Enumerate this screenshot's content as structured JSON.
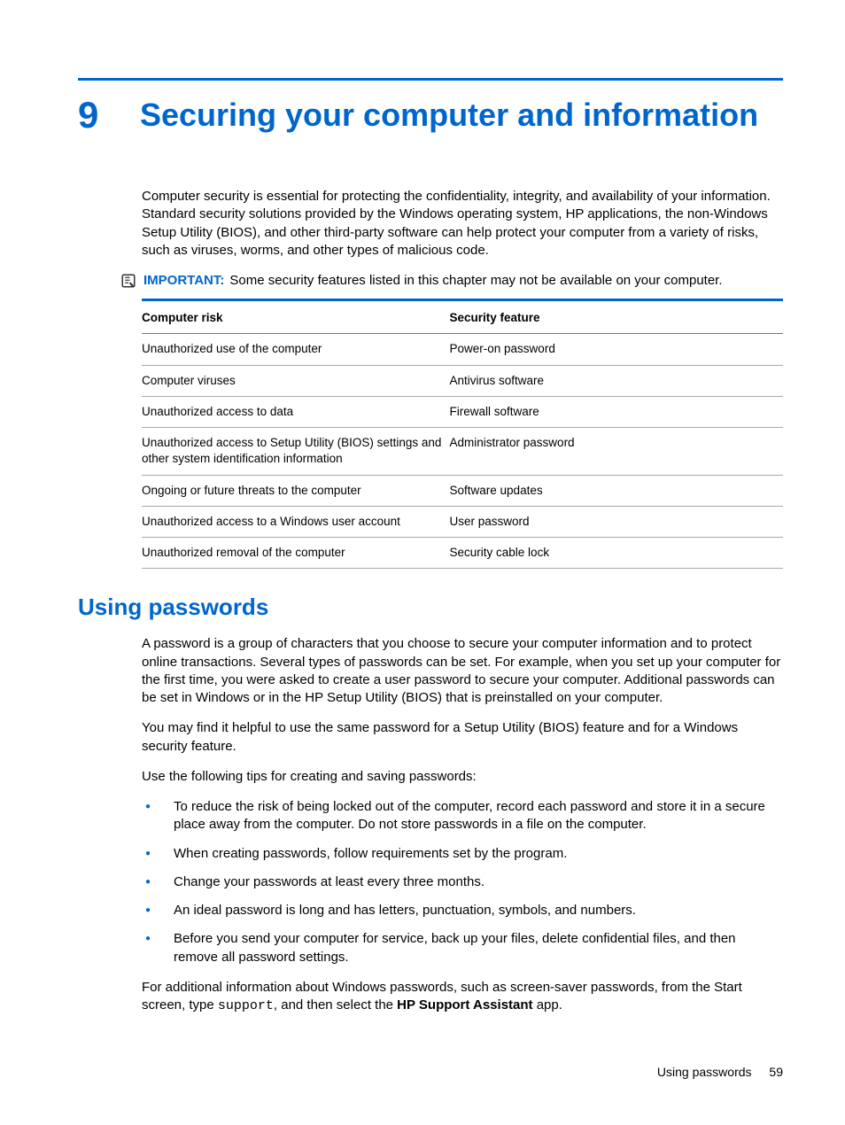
{
  "chapter": {
    "number": "9",
    "title": "Securing your computer and information"
  },
  "intro": "Computer security is essential for protecting the confidentiality, integrity, and availability of your information. Standard security solutions provided by the Windows operating system, HP applications, the non-Windows Setup Utility (BIOS), and other third-party software can help protect your computer from a variety of risks, such as viruses, worms, and other types of malicious code.",
  "important": {
    "label": "IMPORTANT:",
    "text": "Some security features listed in this chapter may not be available on your computer."
  },
  "table": {
    "headers": {
      "col1": "Computer risk",
      "col2": "Security feature"
    },
    "rows": [
      {
        "risk": "Unauthorized use of the computer",
        "feature": "Power-on password"
      },
      {
        "risk": "Computer viruses",
        "feature": "Antivirus software"
      },
      {
        "risk": "Unauthorized access to data",
        "feature": "Firewall software"
      },
      {
        "risk": "Unauthorized access to Setup Utility (BIOS) settings and other system identification information",
        "feature": "Administrator password"
      },
      {
        "risk": "Ongoing or future threats to the computer",
        "feature": "Software updates"
      },
      {
        "risk": "Unauthorized access to a Windows user account",
        "feature": "User password"
      },
      {
        "risk": "Unauthorized removal of the computer",
        "feature": "Security cable lock"
      }
    ]
  },
  "section": {
    "heading": "Using passwords",
    "para1": "A password is a group of characters that you choose to secure your computer information and to protect online transactions. Several types of passwords can be set. For example, when you set up your computer for the first time, you were asked to create a user password to secure your computer. Additional passwords can be set in Windows or in the HP Setup Utility (BIOS) that is preinstalled on your computer.",
    "para2": "You may find it helpful to use the same password for a Setup Utility (BIOS) feature and for a Windows security feature.",
    "para3": "Use the following tips for creating and saving passwords:",
    "tips": [
      "To reduce the risk of being locked out of the computer, record each password and store it in a secure place away from the computer. Do not store passwords in a file on the computer.",
      "When creating passwords, follow requirements set by the program.",
      "Change your passwords at least every three months.",
      "An ideal password is long and has letters, punctuation, symbols, and numbers.",
      "Before you send your computer for service, back up your files, delete confidential files, and then remove all password settings."
    ],
    "para4_pre": "For additional information about Windows passwords, such as screen-saver passwords, from the Start screen, type ",
    "para4_code": "support",
    "para4_mid": ", and then select the ",
    "para4_bold": "HP Support Assistant",
    "para4_post": " app."
  },
  "footer": {
    "label": "Using passwords",
    "page": "59"
  }
}
